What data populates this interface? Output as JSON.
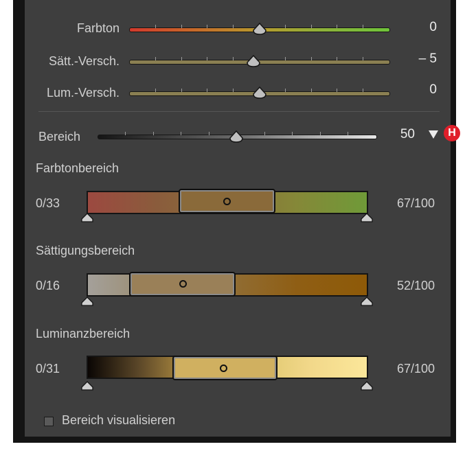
{
  "sliders": {
    "hue": {
      "label": "Farbton",
      "value": "0",
      "position": 0.5
    },
    "saturation_shift": {
      "label": "Sätt.-Versch.",
      "value": "– 5",
      "position": 0.475
    },
    "luminance_shift": {
      "label": "Lum.-Versch.",
      "value": "0",
      "position": 0.5
    }
  },
  "range": {
    "label": "Bereich",
    "value": "50",
    "position": 0.5,
    "dropdown_icon": "triangle-down-icon",
    "badge": "H"
  },
  "hue_range": {
    "heading": "Farbtonbereich",
    "left_value": "0/33",
    "right_value": "67/100"
  },
  "saturation_range": {
    "heading": "Sättigungsbereich",
    "left_value": "0/16",
    "right_value": "52/100"
  },
  "luminance_range": {
    "heading": "Luminanzbereich",
    "left_value": "0/31",
    "right_value": "67/100"
  },
  "visualize": {
    "label": "Bereich visualisieren",
    "checked": false
  },
  "colors": {
    "panel": "#3e3e3e",
    "accent_badge": "#e01f2a"
  }
}
